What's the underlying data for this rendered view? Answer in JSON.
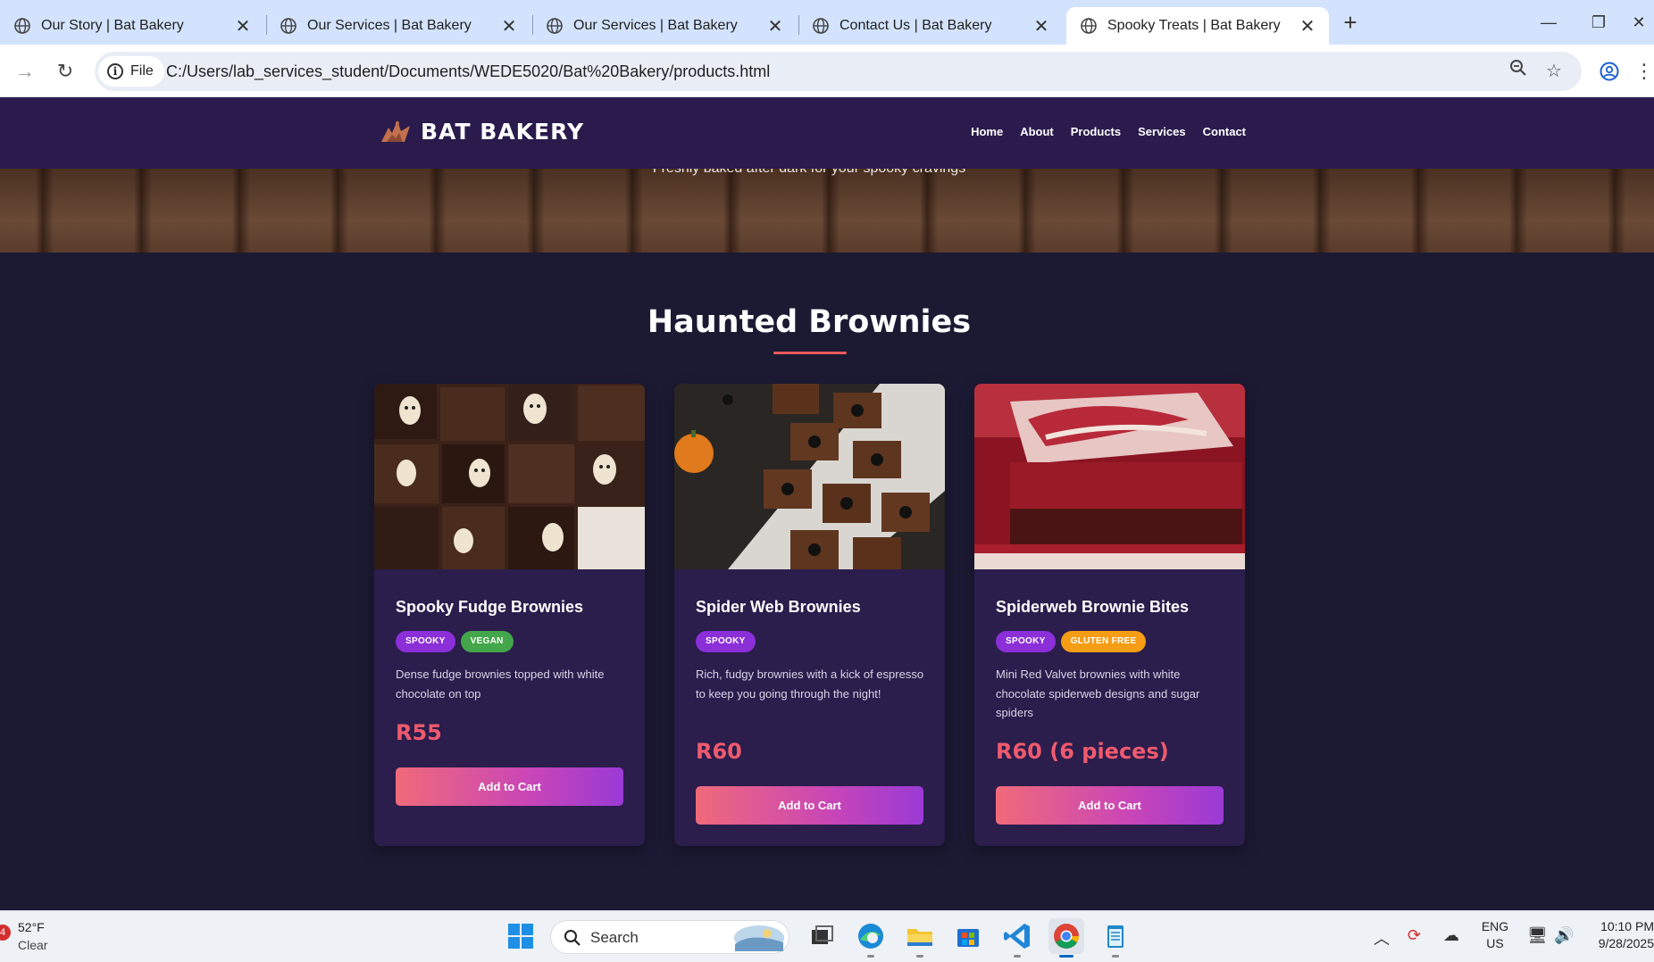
{
  "browser": {
    "tabs": [
      {
        "title": "Our Story | Bat Bakery",
        "active": false
      },
      {
        "title": "Our Services | Bat Bakery",
        "active": false
      },
      {
        "title": "Our Services | Bat Bakery",
        "active": false
      },
      {
        "title": "Contact Us | Bat Bakery",
        "active": false
      },
      {
        "title": "Spooky Treats | Bat Bakery",
        "active": true
      }
    ],
    "new_tab_label": "+",
    "site_chip": "File",
    "url": "C:/Users/lab_services_student/Documents/WEDE5020/Bat%20Bakery/products.html"
  },
  "site": {
    "brand": "BAT BAKERY",
    "nav": [
      "Home",
      "About",
      "Products",
      "Services",
      "Contact"
    ],
    "hero_tagline": "Freshly baked after dark for your spooky cravings",
    "section_title": "Haunted Brownies",
    "accent_color": "#ef5a6e",
    "nav_color": "#2a1b4c"
  },
  "products": [
    {
      "name": "Spooky Fudge Brownies",
      "tags": [
        {
          "label": "SPOOKY",
          "kind": "spooky"
        },
        {
          "label": "VEGAN",
          "kind": "vegan"
        }
      ],
      "description": "Dense fudge brownies topped with white chocolate on top",
      "price": "R55",
      "button": "Add to Cart",
      "image": "ghost-brownies-image"
    },
    {
      "name": "Spider Web Brownies",
      "tags": [
        {
          "label": "SPOOKY",
          "kind": "spooky"
        }
      ],
      "description": "Rich, fudgy brownies with a kick of espresso to keep you going through the night!",
      "price": "R60",
      "button": "Add to Cart",
      "image": "spider-brownies-image"
    },
    {
      "name": "Spiderweb Brownie Bites",
      "tags": [
        {
          "label": "SPOOKY",
          "kind": "spooky"
        },
        {
          "label": "GLUTEN FREE",
          "kind": "gluten"
        }
      ],
      "description": "Mini Red Valvet brownies with white chocolate spiderweb designs and sugar spiders",
      "price": "R60 (6 pieces)",
      "button": "Add to Cart",
      "image": "red-velvet-brownie-image"
    }
  ],
  "taskbar": {
    "weather_badge": "4",
    "weather_temp": "52°F",
    "weather_condition": "Clear",
    "search_label": "Search",
    "lang_line1": "ENG",
    "lang_line2": "US",
    "time": "10:10 PM",
    "date": "9/28/2025"
  }
}
